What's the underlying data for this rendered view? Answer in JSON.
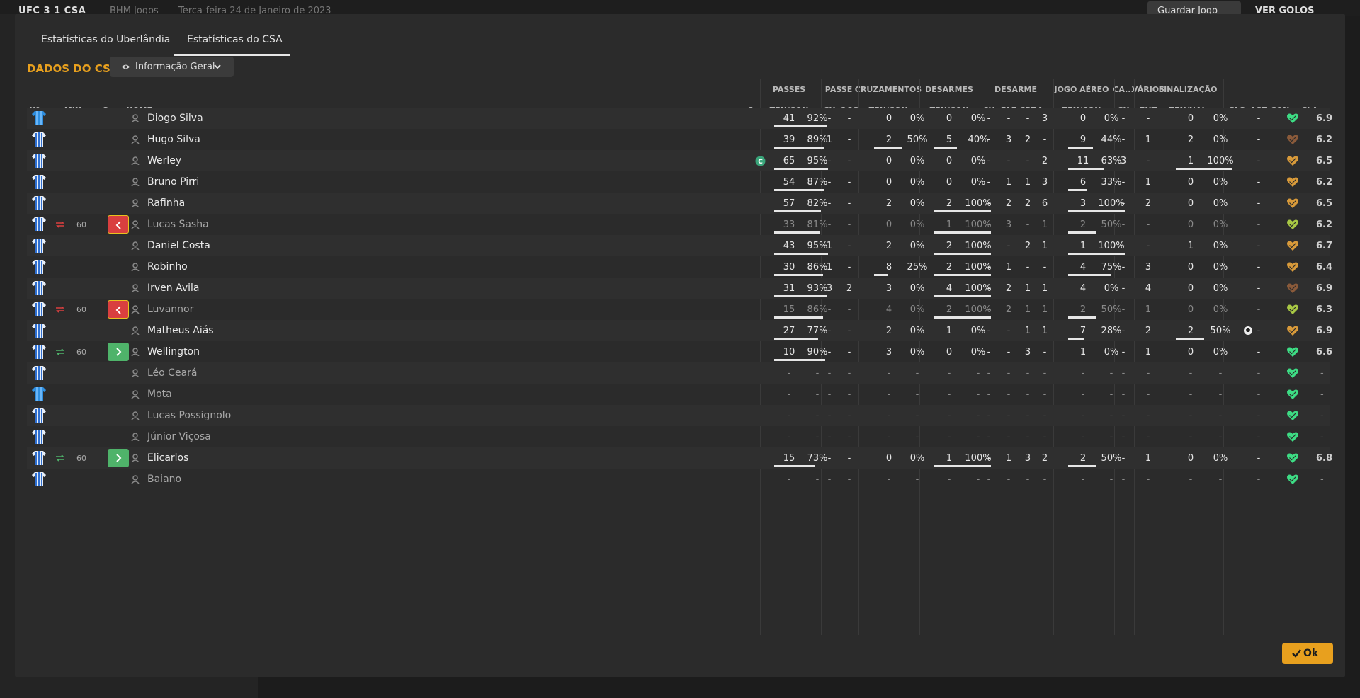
{
  "topbar": {
    "score": "UFC  3  1  CSA",
    "competition": "BHM Jogos",
    "date": "Terça-feira 24 de Janeiro de 2023",
    "save_label": "Guardar Jogo",
    "goals_label": "VER GOLOS"
  },
  "tabs": [
    "Estatísticas do Uberlândia",
    "Estatísticas do CSA"
  ],
  "section_title": "DADOS DO CSA",
  "dropdown_label": "Informação Geral",
  "column_groups": [
    "PASSES",
    "PASSE",
    "CRUZAMENTOS",
    "DESARMES",
    "DESARME",
    "JOGO AÉREO",
    "CA...",
    "VÁRIOS",
    "FINALIZAÇÃO"
  ],
  "column_headers": {
    "num": "Nº",
    "min": "MIN",
    "s": "S",
    "name": "NOME",
    "c": "C",
    "passes": "TEN/CON",
    "passe_ch": "CH",
    "passe_ocg": "OCG",
    "cruz": "TEN/CON",
    "desarmes": "TEN/CON",
    "des_ch": "CH",
    "des_faf": "FAF",
    "des_crt": "CRT",
    "des_a": "A...",
    "aereo": "TEN/CON",
    "ca_ch": "CH",
    "varios_fnt": "FNT",
    "final": "TEN/NAL",
    "gls": "GLS",
    "ast": "AST",
    "con": "CON",
    "cla": "CLA"
  },
  "players": [
    {
      "name": "Diogo Silva",
      "dim": false,
      "sub": "",
      "min": "",
      "cap": false,
      "shirt": "gk",
      "p": [
        "41",
        "92%",
        0.92
      ],
      "ch": "-",
      "ocg": "-",
      "cz": [
        "0",
        "0%",
        0
      ],
      "ds": [
        "0",
        "0%",
        0
      ],
      "dch": "-",
      "faf": "-",
      "crt": "-",
      "a": "3",
      "ae": [
        "0",
        "0%",
        0
      ],
      "cach": "-",
      "fnt": "-",
      "fi": [
        "0",
        "0%",
        0
      ],
      "gls": "",
      "ast": "-",
      "heart": "#3ddc84",
      "cla": "6.9"
    },
    {
      "name": "Hugo Silva",
      "dim": false,
      "sub": "",
      "min": "",
      "cap": false,
      "shirt": "out",
      "p": [
        "39",
        "89%",
        0.89
      ],
      "ch": "1",
      "ocg": "-",
      "cz": [
        "2",
        "50%",
        0.5
      ],
      "ds": [
        "5",
        "40%",
        0.4
      ],
      "dch": "-",
      "faf": "3",
      "crt": "2",
      "a": "-",
      "ae": [
        "9",
        "44%",
        0.44
      ],
      "cach": "-",
      "fnt": "1",
      "fi": [
        "2",
        "0%",
        0
      ],
      "gls": "",
      "ast": "-",
      "heart": "#8a5a3a",
      "cla": "6.2"
    },
    {
      "name": "Werley",
      "dim": false,
      "sub": "",
      "min": "",
      "cap": true,
      "shirt": "out",
      "p": [
        "65",
        "95%",
        0.95
      ],
      "ch": "-",
      "ocg": "-",
      "cz": [
        "0",
        "0%",
        0
      ],
      "ds": [
        "0",
        "0%",
        0
      ],
      "dch": "-",
      "faf": "-",
      "crt": "-",
      "a": "2",
      "ae": [
        "11",
        "63%",
        0.63
      ],
      "cach": "3",
      "fnt": "-",
      "fi": [
        "1",
        "100%",
        1
      ],
      "gls": "",
      "ast": "-",
      "heart": "#d89a3a",
      "cla": "6.5"
    },
    {
      "name": "Bruno Pirri",
      "dim": false,
      "sub": "",
      "min": "",
      "cap": false,
      "shirt": "out",
      "p": [
        "54",
        "87%",
        0.87
      ],
      "ch": "-",
      "ocg": "-",
      "cz": [
        "0",
        "0%",
        0
      ],
      "ds": [
        "0",
        "0%",
        0
      ],
      "dch": "-",
      "faf": "1",
      "crt": "1",
      "a": "3",
      "ae": [
        "6",
        "33%",
        0.33
      ],
      "cach": "-",
      "fnt": "1",
      "fi": [
        "0",
        "0%",
        0
      ],
      "gls": "",
      "ast": "-",
      "heart": "#d89a3a",
      "cla": "6.2"
    },
    {
      "name": "Rafinha",
      "dim": false,
      "sub": "",
      "min": "",
      "cap": false,
      "shirt": "out",
      "p": [
        "57",
        "82%",
        0.82
      ],
      "ch": "-",
      "ocg": "-",
      "cz": [
        "2",
        "0%",
        0
      ],
      "ds": [
        "2",
        "100%",
        1
      ],
      "dch": "-",
      "faf": "2",
      "crt": "2",
      "a": "6",
      "ae": [
        "3",
        "100%",
        1
      ],
      "cach": "-",
      "fnt": "2",
      "fi": [
        "0",
        "0%",
        0
      ],
      "gls": "",
      "ast": "-",
      "heart": "#d89a3a",
      "cla": "6.5"
    },
    {
      "name": "Lucas Sasha",
      "dim": true,
      "sub": "out",
      "min": "60",
      "cap": false,
      "shirt": "out",
      "p": [
        "33",
        "81%",
        0.81
      ],
      "ch": "-",
      "ocg": "-",
      "cz": [
        "0",
        "0%",
        0
      ],
      "ds": [
        "1",
        "100%",
        1
      ],
      "dch": "-",
      "faf": "3",
      "crt": "-",
      "a": "1",
      "ae": [
        "2",
        "50%",
        0.5
      ],
      "cach": "-",
      "fnt": "-",
      "fi": [
        "0",
        "0%",
        0
      ],
      "gls": "",
      "ast": "-",
      "heart": "#a8c844",
      "cla": "6.2"
    },
    {
      "name": "Daniel Costa",
      "dim": false,
      "sub": "",
      "min": "",
      "cap": false,
      "shirt": "out",
      "p": [
        "43",
        "95%",
        0.95
      ],
      "ch": "1",
      "ocg": "-",
      "cz": [
        "2",
        "0%",
        0
      ],
      "ds": [
        "2",
        "100%",
        1
      ],
      "dch": "-",
      "faf": "-",
      "crt": "2",
      "a": "1",
      "ae": [
        "1",
        "100%",
        1
      ],
      "cach": "-",
      "fnt": "-",
      "fi": [
        "1",
        "0%",
        0
      ],
      "gls": "",
      "ast": "-",
      "heart": "#d89a3a",
      "cla": "6.7"
    },
    {
      "name": "Robinho",
      "dim": false,
      "sub": "",
      "min": "",
      "cap": false,
      "shirt": "out",
      "p": [
        "30",
        "86%",
        0.86
      ],
      "ch": "1",
      "ocg": "-",
      "cz": [
        "8",
        "25%",
        0.25
      ],
      "ds": [
        "2",
        "100%",
        1
      ],
      "dch": "-",
      "faf": "1",
      "crt": "-",
      "a": "-",
      "ae": [
        "4",
        "75%",
        0.75
      ],
      "cach": "-",
      "fnt": "3",
      "fi": [
        "0",
        "0%",
        0
      ],
      "gls": "",
      "ast": "-",
      "heart": "#d89a3a",
      "cla": "6.4"
    },
    {
      "name": "Irven Avila",
      "dim": false,
      "sub": "",
      "min": "",
      "cap": false,
      "shirt": "out",
      "p": [
        "31",
        "93%",
        0.93
      ],
      "ch": "3",
      "ocg": "2",
      "cz": [
        "3",
        "0%",
        0
      ],
      "ds": [
        "4",
        "100%",
        1
      ],
      "dch": "-",
      "faf": "2",
      "crt": "1",
      "a": "1",
      "ae": [
        "4",
        "0%",
        0
      ],
      "cach": "-",
      "fnt": "4",
      "fi": [
        "0",
        "0%",
        0
      ],
      "gls": "",
      "ast": "-",
      "heart": "#8a5a3a",
      "cla": "6.9"
    },
    {
      "name": "Luvannor",
      "dim": true,
      "sub": "out",
      "min": "60",
      "cap": false,
      "shirt": "out",
      "p": [
        "15",
        "86%",
        0.86
      ],
      "ch": "-",
      "ocg": "-",
      "cz": [
        "4",
        "0%",
        0
      ],
      "ds": [
        "2",
        "100%",
        1
      ],
      "dch": "-",
      "faf": "2",
      "crt": "1",
      "a": "1",
      "ae": [
        "2",
        "50%",
        0.5
      ],
      "cach": "-",
      "fnt": "1",
      "fi": [
        "0",
        "0%",
        0
      ],
      "gls": "",
      "ast": "-",
      "heart": "#a8c844",
      "cla": "6.3"
    },
    {
      "name": "Matheus Aiás",
      "dim": false,
      "sub": "",
      "min": "",
      "cap": false,
      "shirt": "out",
      "p": [
        "27",
        "77%",
        0.77
      ],
      "ch": "-",
      "ocg": "-",
      "cz": [
        "2",
        "0%",
        0
      ],
      "ds": [
        "1",
        "0%",
        0
      ],
      "dch": "-",
      "faf": "-",
      "crt": "1",
      "a": "1",
      "ae": [
        "7",
        "28%",
        0.28
      ],
      "cach": "-",
      "fnt": "2",
      "fi": [
        "2",
        "50%",
        0.5
      ],
      "gls": "ball",
      "ast": "-",
      "heart": "#d89a3a",
      "cla": "6.9"
    },
    {
      "name": "Wellington",
      "dim": false,
      "sub": "in",
      "min": "60",
      "cap": false,
      "shirt": "out",
      "p": [
        "10",
        "90%",
        0.9
      ],
      "ch": "-",
      "ocg": "-",
      "cz": [
        "3",
        "0%",
        0
      ],
      "ds": [
        "0",
        "0%",
        0
      ],
      "dch": "-",
      "faf": "-",
      "crt": "3",
      "a": "-",
      "ae": [
        "1",
        "0%",
        0
      ],
      "cach": "-",
      "fnt": "1",
      "fi": [
        "0",
        "0%",
        0
      ],
      "gls": "",
      "ast": "-",
      "heart": "#3ddc84",
      "cla": "6.6"
    },
    {
      "name": "Léo Ceará",
      "dim": true,
      "sub": "",
      "min": "",
      "cap": false,
      "shirt": "out",
      "p": [
        "-",
        "-",
        0
      ],
      "ch": "-",
      "ocg": "-",
      "cz": [
        "-",
        "-",
        0
      ],
      "ds": [
        "-",
        "-",
        0
      ],
      "dch": "-",
      "faf": "-",
      "crt": "-",
      "a": "-",
      "ae": [
        "-",
        "-",
        0
      ],
      "cach": "-",
      "fnt": "-",
      "fi": [
        "-",
        "-",
        0
      ],
      "gls": "",
      "ast": "-",
      "heart": "#3ddc84",
      "cla": "-"
    },
    {
      "name": "Mota",
      "dim": true,
      "sub": "",
      "min": "",
      "cap": false,
      "shirt": "gk",
      "p": [
        "-",
        "-",
        0
      ],
      "ch": "-",
      "ocg": "-",
      "cz": [
        "-",
        "-",
        0
      ],
      "ds": [
        "-",
        "-",
        0
      ],
      "dch": "-",
      "faf": "-",
      "crt": "-",
      "a": "-",
      "ae": [
        "-",
        "-",
        0
      ],
      "cach": "-",
      "fnt": "-",
      "fi": [
        "-",
        "-",
        0
      ],
      "gls": "",
      "ast": "-",
      "heart": "#3ddc84",
      "cla": "-"
    },
    {
      "name": "Lucas Possignolo",
      "dim": true,
      "sub": "",
      "min": "",
      "cap": false,
      "shirt": "out",
      "p": [
        "-",
        "-",
        0
      ],
      "ch": "-",
      "ocg": "-",
      "cz": [
        "-",
        "-",
        0
      ],
      "ds": [
        "-",
        "-",
        0
      ],
      "dch": "-",
      "faf": "-",
      "crt": "-",
      "a": "-",
      "ae": [
        "-",
        "-",
        0
      ],
      "cach": "-",
      "fnt": "-",
      "fi": [
        "-",
        "-",
        0
      ],
      "gls": "",
      "ast": "-",
      "heart": "#3ddc84",
      "cla": "-"
    },
    {
      "name": "Júnior Viçosa",
      "dim": true,
      "sub": "",
      "min": "",
      "cap": false,
      "shirt": "out",
      "p": [
        "-",
        "-",
        0
      ],
      "ch": "-",
      "ocg": "-",
      "cz": [
        "-",
        "-",
        0
      ],
      "ds": [
        "-",
        "-",
        0
      ],
      "dch": "-",
      "faf": "-",
      "crt": "-",
      "a": "-",
      "ae": [
        "-",
        "-",
        0
      ],
      "cach": "-",
      "fnt": "-",
      "fi": [
        "-",
        "-",
        0
      ],
      "gls": "",
      "ast": "-",
      "heart": "#3ddc84",
      "cla": "-"
    },
    {
      "name": "Elicarlos",
      "dim": false,
      "sub": "in",
      "min": "60",
      "cap": false,
      "shirt": "out",
      "p": [
        "15",
        "73%",
        0.73
      ],
      "ch": "-",
      "ocg": "-",
      "cz": [
        "0",
        "0%",
        0
      ],
      "ds": [
        "1",
        "100%",
        1
      ],
      "dch": "-",
      "faf": "1",
      "crt": "3",
      "a": "2",
      "ae": [
        "2",
        "50%",
        0.5
      ],
      "cach": "-",
      "fnt": "1",
      "fi": [
        "0",
        "0%",
        0
      ],
      "gls": "",
      "ast": "-",
      "heart": "#3ddc84",
      "cla": "6.8"
    },
    {
      "name": "Baiano",
      "dim": true,
      "sub": "",
      "min": "",
      "cap": false,
      "shirt": "out",
      "p": [
        "-",
        "-",
        0
      ],
      "ch": "-",
      "ocg": "-",
      "cz": [
        "-",
        "-",
        0
      ],
      "ds": [
        "-",
        "-",
        0
      ],
      "dch": "-",
      "faf": "-",
      "crt": "-",
      "a": "-",
      "ae": [
        "-",
        "-",
        0
      ],
      "cach": "-",
      "fnt": "-",
      "fi": [
        "-",
        "-",
        0
      ],
      "gls": "",
      "ast": "-",
      "heart": "#3ddc84",
      "cla": "-"
    }
  ],
  "ok_label": "Ok",
  "colors": {
    "accent": "#e8a01e",
    "sub_out": "#d93f3f",
    "sub_in": "#4fb36a",
    "shirt_blue": "#2f8fe0",
    "captain": "#3aa57a"
  }
}
